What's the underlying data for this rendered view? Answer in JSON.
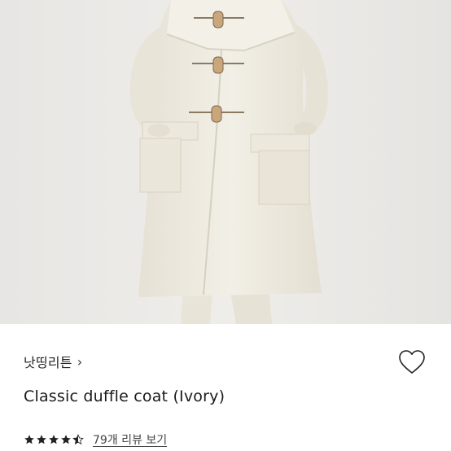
{
  "product_image": {
    "icon": "duffle-coat-photo"
  },
  "brand": {
    "name": "낫띵리튼",
    "chevron": "›"
  },
  "product": {
    "title": "Classic duffle coat (Ivory)"
  },
  "wishlist": {
    "icon": "heart-outline-icon"
  },
  "rating": {
    "stars": 4.5,
    "review_link": "79개 리뷰 보기"
  },
  "colors": {
    "text": "#1a1a1a",
    "star": "#222222",
    "image_bg": "#ebe9e6",
    "coat": "#efebe1"
  }
}
